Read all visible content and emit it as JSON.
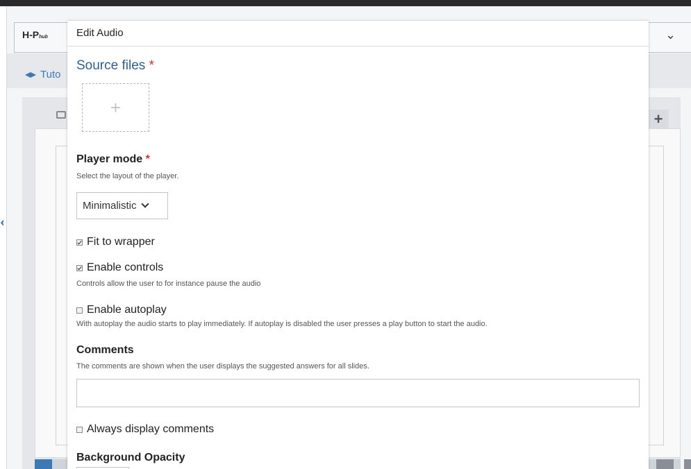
{
  "background": {
    "logo": "H-P",
    "logo_suffix": "hub",
    "tab_label": "Tuto"
  },
  "dialog": {
    "title": "Edit Audio",
    "source_files": {
      "label": "Source files",
      "required_mark": "*",
      "add_glyph": "+"
    },
    "player_mode": {
      "label": "Player mode",
      "required_mark": "*",
      "description": "Select the layout of the player.",
      "selected": "Minimalistic"
    },
    "fit_to_wrapper": {
      "label": "Fit to wrapper",
      "checked": true
    },
    "enable_controls": {
      "label": "Enable controls",
      "checked": true,
      "description": "Controls allow the user to for instance pause the audio"
    },
    "enable_autoplay": {
      "label": "Enable autoplay",
      "checked": false,
      "description": "With autoplay the audio starts to play immediately. If autoplay is disabled the user presses a play button to start the audio."
    },
    "comments": {
      "label": "Comments",
      "description": "The comments are shown when the user displays the suggested answers for all slides.",
      "value": ""
    },
    "always_display_comments": {
      "label": "Always display comments",
      "checked": false
    },
    "background_opacity": {
      "label": "Background Opacity"
    }
  },
  "colors": {
    "accent": "#2f5f8f",
    "required": "#d0312d",
    "brand_blue": "#3c7ab5"
  }
}
